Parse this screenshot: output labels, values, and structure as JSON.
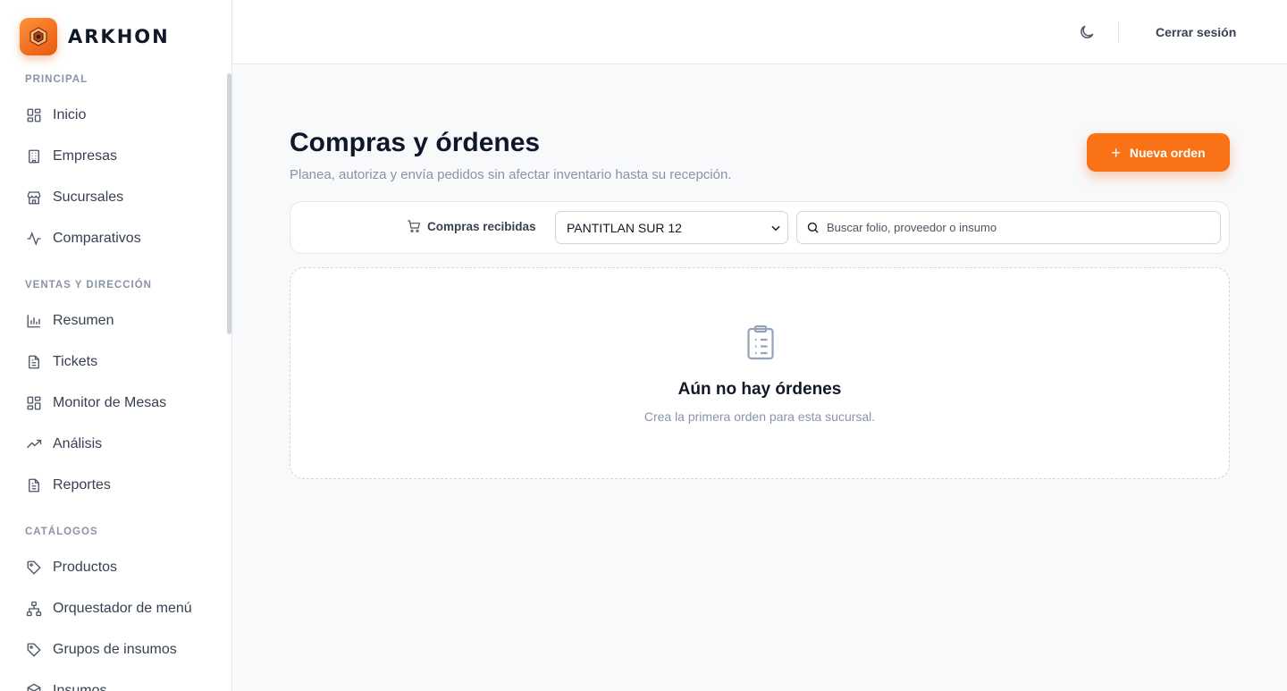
{
  "brand": {
    "name": "ARKHON"
  },
  "sidebar": {
    "sections": [
      {
        "title": "PRINCIPAL",
        "items": [
          {
            "label": "Inicio",
            "icon": "grid-icon"
          },
          {
            "label": "Empresas",
            "icon": "building-icon"
          },
          {
            "label": "Sucursales",
            "icon": "store-icon"
          },
          {
            "label": "Comparativos",
            "icon": "activity-icon"
          }
        ]
      },
      {
        "title": "VENTAS Y DIRECCIÓN",
        "items": [
          {
            "label": "Resumen",
            "icon": "bar-chart-icon"
          },
          {
            "label": "Tickets",
            "icon": "file-text-icon"
          },
          {
            "label": "Monitor de Mesas",
            "icon": "grid-icon"
          },
          {
            "label": "Análisis",
            "icon": "trending-up-icon"
          },
          {
            "label": "Reportes",
            "icon": "file-text-icon"
          }
        ]
      },
      {
        "title": "CATÁLOGOS",
        "items": [
          {
            "label": "Productos",
            "icon": "tag-icon"
          },
          {
            "label": "Orquestador de menú",
            "icon": "sitemap-icon"
          },
          {
            "label": "Grupos de insumos",
            "icon": "tag-icon"
          },
          {
            "label": "Insumos",
            "icon": "box-icon"
          }
        ]
      }
    ]
  },
  "topbar": {
    "logout_label": "Cerrar sesión",
    "theme_icon": "moon-icon"
  },
  "main": {
    "title": "Compras y órdenes",
    "subtitle": "Planea, autoriza y envía pedidos sin afectar inventario hasta su recepción.",
    "new_order_label": "Nueva orden",
    "filters": {
      "received_label": "Compras recibidas",
      "branch_selected": "PANTITLAN SUR 12",
      "search_placeholder": "Buscar folio, proveedor o insumo"
    },
    "empty": {
      "title": "Aún no hay órdenes",
      "subtitle": "Crea la primera orden para esta sucursal."
    }
  },
  "colors": {
    "accent": "#f97316",
    "text_muted": "#8a94a6",
    "border": "#e5e7eb"
  }
}
